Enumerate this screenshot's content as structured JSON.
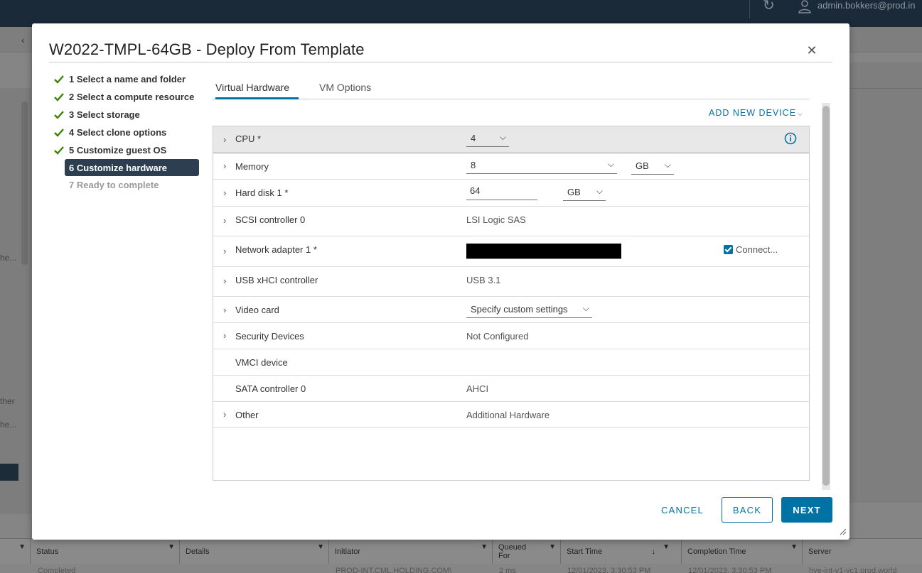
{
  "background": {
    "user_name": "admin.bokkers@prod.in",
    "left_fragments": [
      "he...",
      "ther",
      "he..."
    ],
    "tasks_table": {
      "columns": [
        {
          "label": ""
        },
        {
          "label": "Status"
        },
        {
          "label": "Details"
        },
        {
          "label": "Initiator"
        },
        {
          "label": "Queued For"
        },
        {
          "label": "Start Time"
        },
        {
          "label": "Completion Time"
        },
        {
          "label": "Server"
        }
      ],
      "row": [
        "Completed",
        "PROD-INT.CML.HOLDING.COM\\",
        "2 ms",
        "12/01/2023, 3:30:53 PM",
        "12/01/2023, 3:30:53 PM",
        "hve-int-v1-vc1.prod.world"
      ]
    }
  },
  "dialog": {
    "title": "W2022-TMPL-64GB - Deploy From Template",
    "close_icon": "close-icon",
    "steps": [
      {
        "label": "1 Select a name and folder",
        "state": "done"
      },
      {
        "label": "2 Select a compute resource",
        "state": "done"
      },
      {
        "label": "3 Select storage",
        "state": "done"
      },
      {
        "label": "4 Select clone options",
        "state": "done"
      },
      {
        "label": "5 Customize guest OS",
        "state": "done"
      },
      {
        "label": "6 Customize hardware",
        "state": "active"
      },
      {
        "label": "7 Ready to complete",
        "state": "pending"
      }
    ],
    "tabs": [
      {
        "label": "Virtual Hardware",
        "active": true
      },
      {
        "label": "VM Options",
        "active": false
      }
    ],
    "add_new_device": "ADD NEW DEVICE",
    "hardware": {
      "cpu": {
        "label": "CPU *",
        "value": "4"
      },
      "memory": {
        "label": "Memory",
        "value": "8",
        "unit": "GB"
      },
      "hard_disk": {
        "label": "Hard disk 1 *",
        "value": "64",
        "unit": "GB"
      },
      "scsi": {
        "label": "SCSI controller 0",
        "value": "LSI Logic SAS"
      },
      "network": {
        "label": "Network adapter 1 *",
        "connect_label": "Connect...",
        "connected": true
      },
      "usb": {
        "label": "USB xHCI controller",
        "value": "USB 3.1"
      },
      "video": {
        "label": "Video card",
        "value": "Specify custom settings"
      },
      "security": {
        "label": "Security Devices",
        "value": "Not Configured"
      },
      "vmci": {
        "label": "VMCI device",
        "value": ""
      },
      "sata": {
        "label": "SATA controller 0",
        "value": "AHCI"
      },
      "other": {
        "label": "Other",
        "value": "Additional Hardware"
      }
    },
    "buttons": {
      "cancel": "CANCEL",
      "back": "BACK",
      "next": "NEXT"
    },
    "colors": {
      "accent": "#0072a3",
      "active_step": "#2c3e50",
      "check": "#3c8500"
    }
  }
}
